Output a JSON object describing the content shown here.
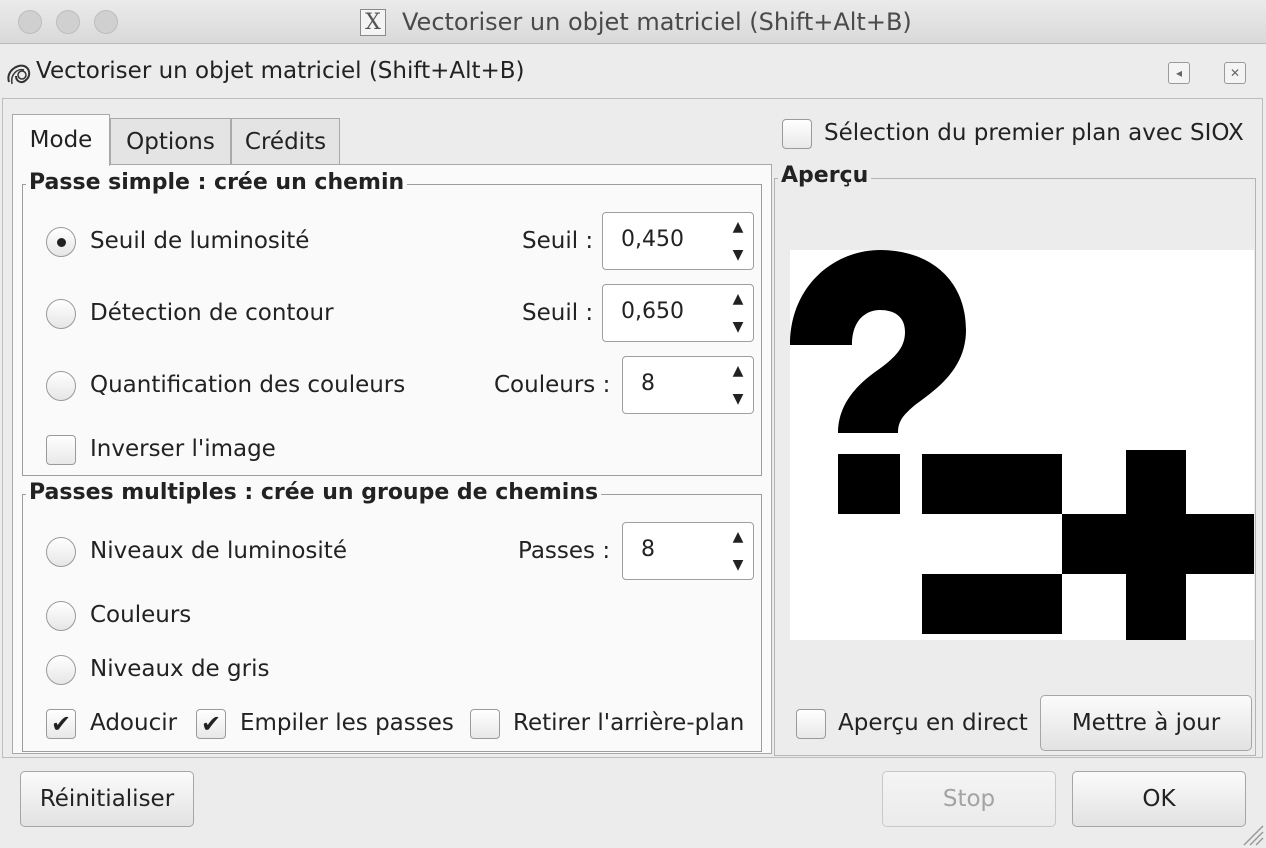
{
  "window": {
    "title": "Vectoriser un objet matriciel (Shift+Alt+B)",
    "title_icon": "X"
  },
  "dock": {
    "title": "Vectoriser un objet matriciel (Shift+Alt+B)",
    "collapse_glyph": "◂",
    "close_glyph": "✕"
  },
  "tabs": [
    {
      "label": "Mode"
    },
    {
      "label": "Options"
    },
    {
      "label": "Crédits"
    }
  ],
  "single_pass": {
    "legend": "Passe simple : crée un chemin",
    "brightness": {
      "label": "Seuil de luminosité",
      "param_label": "Seuil :",
      "value": "0,450"
    },
    "edge": {
      "label": "Détection de contour",
      "param_label": "Seuil :",
      "value": "0,650"
    },
    "quant": {
      "label": "Quantification des couleurs",
      "param_label": "Couleurs :",
      "value": "8"
    },
    "invert": {
      "label": "Inverser l'image"
    }
  },
  "multi_pass": {
    "legend": "Passes multiples : crée un groupe de chemins",
    "levels": {
      "label": "Niveaux de luminosité",
      "param_label": "Passes :",
      "value": "8"
    },
    "colors": {
      "label": "Couleurs"
    },
    "grays": {
      "label": "Niveaux de gris"
    },
    "smooth": {
      "label": "Adoucir"
    },
    "stack": {
      "label": "Empiler les passes"
    },
    "remove_bg": {
      "label": "Retirer l'arrière-plan"
    }
  },
  "siox": {
    "label": "Sélection du premier plan avec SIOX"
  },
  "preview": {
    "legend": "Aperçu",
    "live": {
      "label": "Aperçu en direct"
    },
    "update_label": "Mettre à jour"
  },
  "footer": {
    "reset_label": "Réinitialiser",
    "stop_label": "Stop",
    "ok_label": "OK"
  },
  "arrows": {
    "up": "▲",
    "down": "▼"
  },
  "check_glyph": "✔",
  "colors": {
    "window_bg": "#ececec",
    "panel_bg": "#fafafa",
    "preview_ink": "#000000"
  }
}
